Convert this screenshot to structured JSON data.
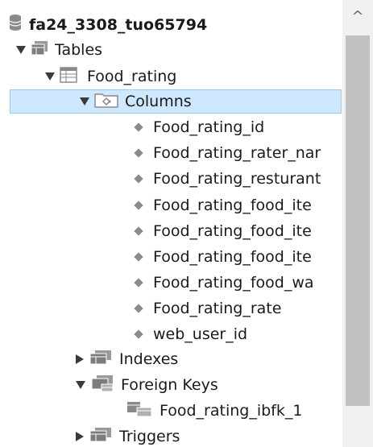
{
  "tree": {
    "schema": {
      "label": "fa24_3308_tuo65794",
      "icon": "database-icon"
    },
    "tables": {
      "label": "Tables",
      "icon": "tables-folder-icon",
      "expanded": true
    },
    "table": {
      "label": "Food_rating",
      "icon": "table-icon",
      "expanded": true
    },
    "columns_folder": {
      "label": "Columns",
      "icon": "columns-folder-icon",
      "expanded": true,
      "selected": true
    },
    "columns": [
      "Food_rating_id",
      "Food_rating_rater_nar",
      "Food_rating_resturant",
      "Food_rating_food_ite",
      "Food_rating_food_ite",
      "Food_rating_food_ite",
      "Food_rating_food_wa",
      "Food_rating_rate",
      "web_user_id"
    ],
    "indexes_folder": {
      "label": "Indexes",
      "icon": "indexes-folder-icon",
      "expanded": false
    },
    "fk_folder": {
      "label": "Foreign Keys",
      "icon": "foreign-keys-folder-icon",
      "expanded": true
    },
    "fk_item": {
      "label": "Food_rating_ibfk_1",
      "icon": "foreign-key-icon"
    },
    "triggers_folder": {
      "label": "Triggers",
      "icon": "triggers-folder-icon",
      "expanded": false
    }
  },
  "scrollbar": {
    "up_arrow": "^"
  },
  "colors": {
    "selection_bg": "#cde8ff",
    "selection_border": "#99c9ef",
    "scrollbar_track": "#f0f0f0",
    "scrollbar_thumb": "#c1c1c1"
  }
}
